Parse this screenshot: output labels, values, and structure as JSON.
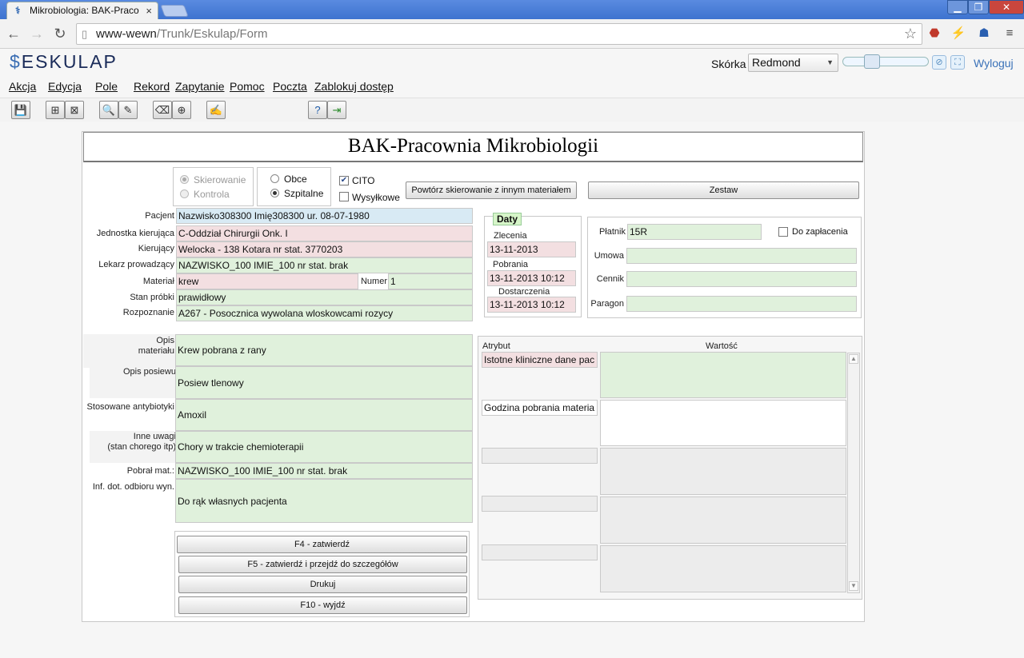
{
  "browser": {
    "tab_title": "Mikrobiologia: BAK-Praco",
    "tab_close": "×",
    "url_host": "www-wewn",
    "url_path": "/Trunk/Eskulap/Form",
    "win_min": "▁",
    "win_max": "❐",
    "win_close": "✕"
  },
  "app": {
    "logo": "ESKULAP",
    "logo_symbol": "$",
    "skin_label": "Skórka",
    "skin_value": "Redmond",
    "logout": "Wyloguj"
  },
  "menu": [
    "Akcja",
    "Edycja",
    "Pole",
    "Rekord",
    "Zapytanie",
    "Pomoc",
    "Poczta",
    "Zablokuj dostęp"
  ],
  "form": {
    "title": "BAK-Pracownia Mikrobiologii",
    "referral_type": {
      "options": [
        "Skierowanie",
        "Kontrola"
      ],
      "selected": "Skierowanie"
    },
    "patient_origin": {
      "options": [
        "Obce",
        "Szpitalne"
      ],
      "selected": "Szpitalne"
    },
    "cito_label": "CITO",
    "cito_checked": true,
    "shipping_label": "Wysyłkowe",
    "shipping_checked": false,
    "repeat_button": "Powtórz skierowanie z innym materiałem",
    "set_button": "Zestaw",
    "fields": {
      "patient": {
        "label": "Pacjent",
        "value": "Nazwisko308300 Imię308300 ur. 08-07-1980"
      },
      "unit": {
        "label": "Jednostka kierująca",
        "value": "C-Oddział Chirurgii Onk. I"
      },
      "referring": {
        "label": "Kierujący",
        "value": "Welocka - 138 Kotara nr stat. 3770203"
      },
      "doctor": {
        "label": "Lekarz prowadzący",
        "value": "NAZWISKO_100 IMIE_100 nr stat. brak"
      },
      "material": {
        "label": "Materiał",
        "value": "krew"
      },
      "number": {
        "label": "Numer",
        "value": "1"
      },
      "sample_state": {
        "label": "Stan próbki",
        "value": "prawidłowy"
      },
      "diagnosis": {
        "label": "Rozpoznanie",
        "value": "A267 - Posocznica wywolana wloskowcami rozycy"
      }
    },
    "dates": {
      "title": "Daty",
      "order_label": "Zlecenia",
      "order_value": "13-11-2013",
      "collection_label": "Pobrania",
      "collection_value": "13-11-2013 10:12",
      "delivery_label": "Dostarczenia",
      "delivery_value": "13-11-2013 10:12"
    },
    "payer": {
      "payer_label": "Płatnik",
      "payer_value": "15R",
      "to_pay_label": "Do zapłacenia",
      "to_pay_checked": false,
      "contract_label": "Umowa",
      "contract_value": "",
      "pricelist_label": "Cennik",
      "pricelist_value": "",
      "receipt_label": "Paragon",
      "receipt_value": ""
    },
    "descriptions": {
      "material_desc_label_1": "Opis",
      "material_desc_label_2": "materiału",
      "material_desc_value": "Krew pobrana z rany",
      "culture_desc_label": "Opis posiewu",
      "culture_desc_value": "Posiew tlenowy",
      "antibiotics_label": "Stosowane antybiotyki",
      "antibiotics_value": "Amoxil",
      "other_label_1": "Inne uwagi",
      "other_label_2": "(stan chorego itp)",
      "other_value": "Chory w trakcie chemioterapii",
      "collected_by_label": "Pobrał mat.:",
      "collected_by_value": "NAZWISKO_100 IMIE_100 nr stat. brak",
      "pickup_label": "Inf. dot. odbioru wyn.",
      "pickup_value": "Do rąk własnych pacjenta"
    },
    "attributes": {
      "col_attr": "Atrybut",
      "col_value": "Wartość",
      "rows": [
        {
          "attr": "Istotne kliniczne dane pac",
          "value": ""
        },
        {
          "attr": "Godzina pobrania materia",
          "value": ""
        },
        {
          "attr": "",
          "value": ""
        },
        {
          "attr": "",
          "value": ""
        },
        {
          "attr": "",
          "value": ""
        }
      ]
    },
    "actions": {
      "confirm": "F4 - zatwierdź",
      "confirm_details": "F5 - zatwierdź i przejdź do szczegółów",
      "print": "Drukuj",
      "exit": "F10 - wyjdź"
    }
  }
}
